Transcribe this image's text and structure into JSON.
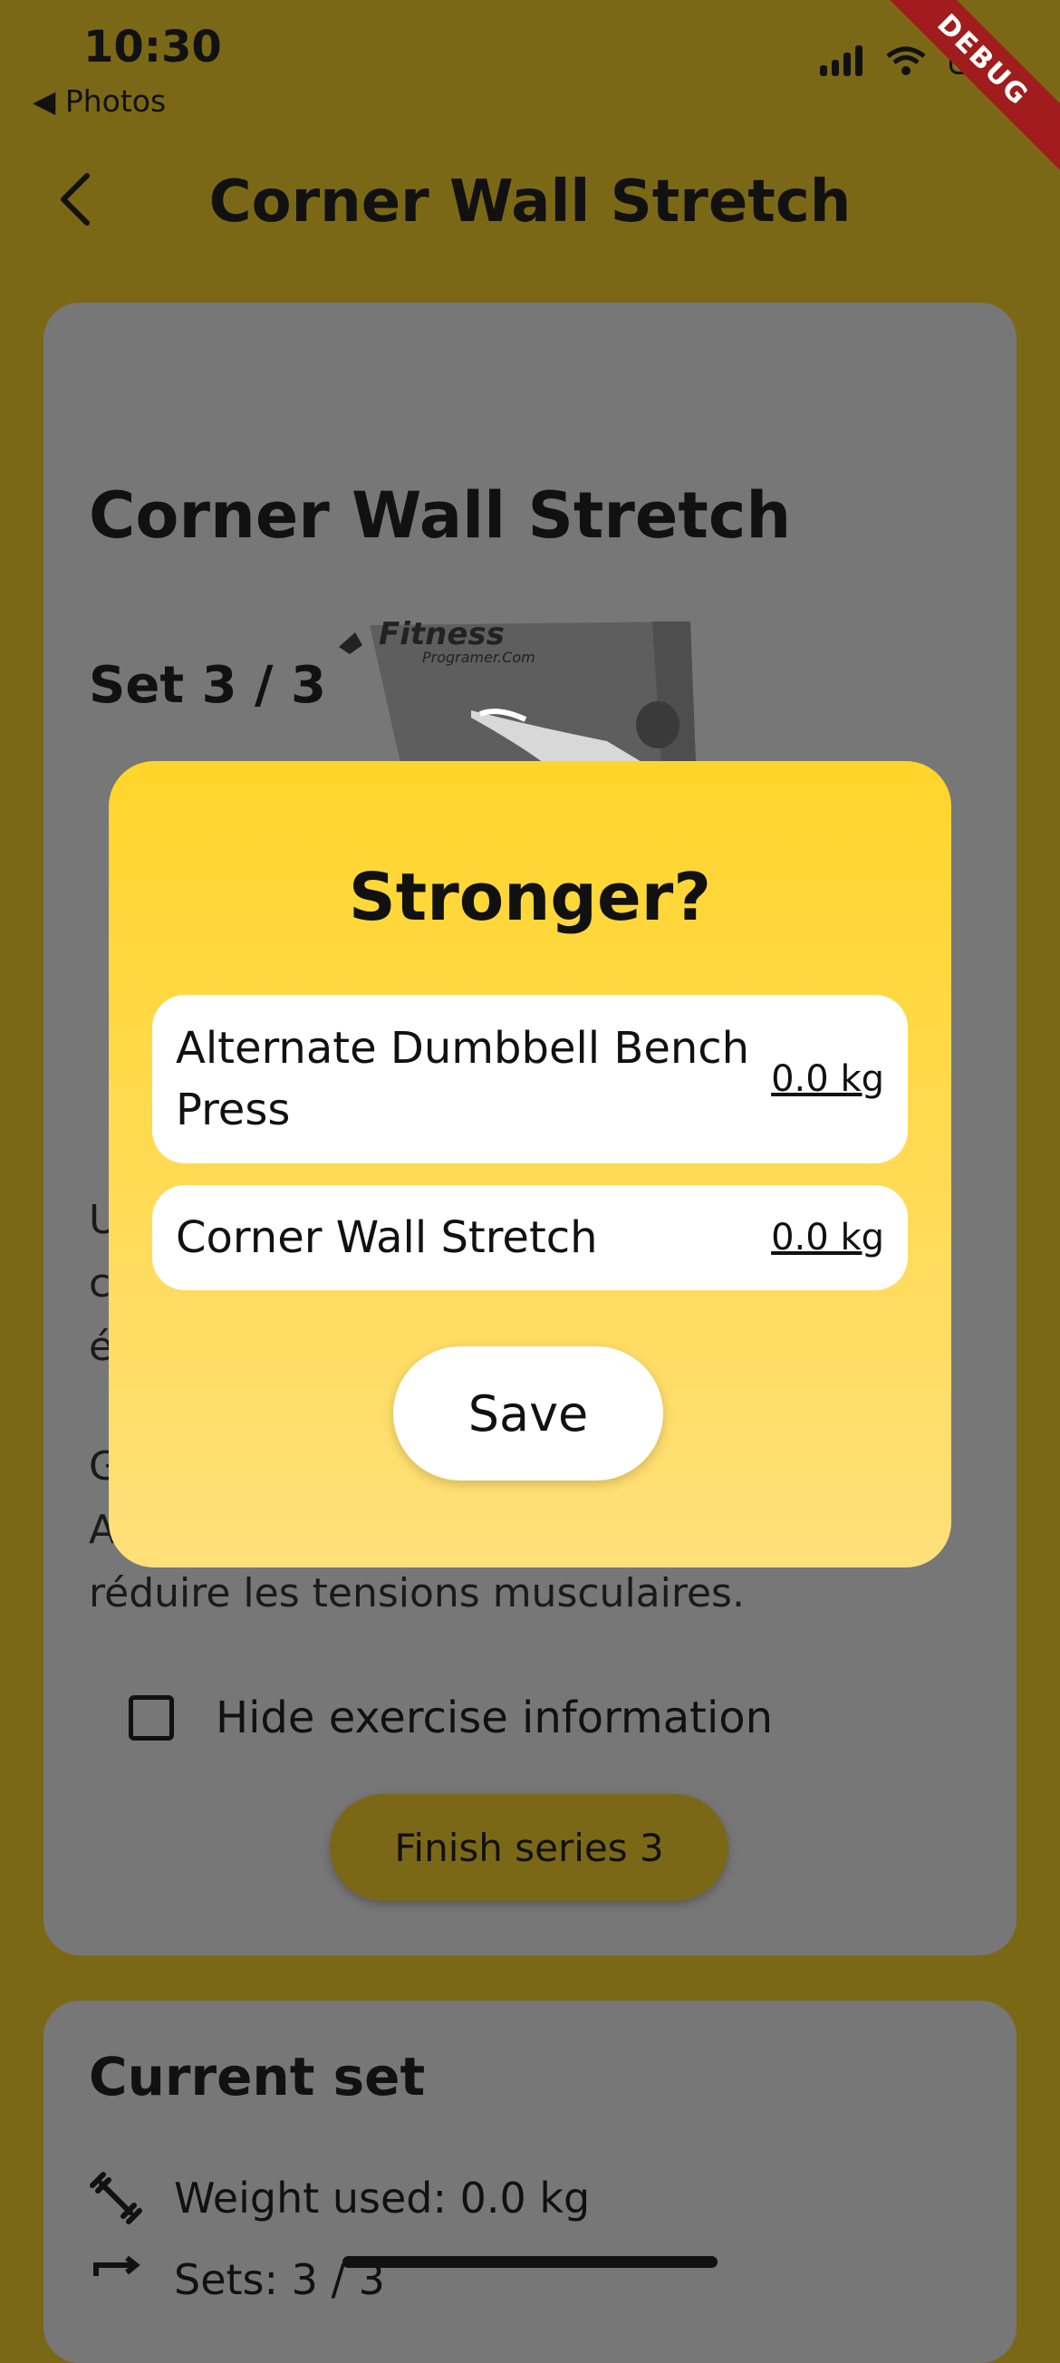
{
  "status_bar": {
    "time": "10:30",
    "back_app": "◀ Photos",
    "debug_label": "DEBUG"
  },
  "app_bar": {
    "title": "Corner Wall Stretch",
    "back_icon": "chevron-left-icon"
  },
  "workout_card": {
    "set_label": "Set 3 / 3",
    "exercise_title": "Corner Wall Stretch",
    "image_logo": "Fitness",
    "image_logo_sub": "Programer.Com",
    "description_1_visible": "U\nc\né",
    "description_2_end": "réduire les tensions musculaires.",
    "description_2_visible": "G\nA",
    "hide_info_label": "Hide exercise information",
    "finish_button": "Finish series 3"
  },
  "current_set": {
    "title": "Current set",
    "weight_used": "Weight used: 0.0 kg",
    "sets": "Sets: 3 / 3"
  },
  "dialog": {
    "title": "Stronger?",
    "items": [
      {
        "name": "Alternate Dumbbell Bench Press",
        "weight": "0.0 kg"
      },
      {
        "name": "Corner Wall Stretch",
        "weight": "0.0 kg"
      }
    ],
    "save_button": "Save"
  },
  "colors": {
    "background": "#7b6817",
    "card": "#777777",
    "dialog_top": "#ffd52b",
    "dialog_bottom": "#ffe07a",
    "debug_banner": "#a11c1c"
  }
}
